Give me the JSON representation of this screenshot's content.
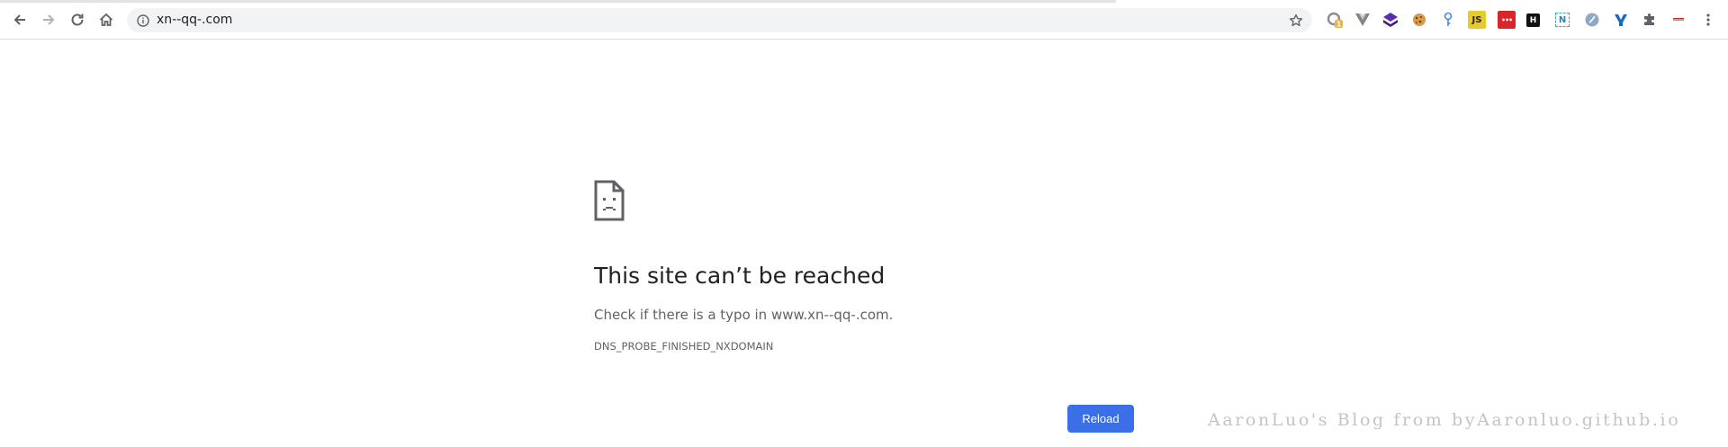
{
  "browser": {
    "url": "xn--qq-.com",
    "extensions": [
      {
        "name": "ext-loading-badge-icon",
        "badge": "1"
      },
      {
        "name": "ext-vue-icon"
      },
      {
        "name": "ext-purple-stack-icon"
      },
      {
        "name": "ext-cookie-icon"
      },
      {
        "name": "ext-key-icon"
      },
      {
        "name": "ext-js-icon",
        "text": "JS"
      },
      {
        "name": "ext-red-dots-icon",
        "text": "•••"
      },
      {
        "name": "ext-h-icon",
        "text": "H"
      },
      {
        "name": "ext-n-icon",
        "text": "N"
      },
      {
        "name": "ext-globe-icon"
      },
      {
        "name": "ext-y-icon"
      },
      {
        "name": "extensions-puzzle-icon"
      },
      {
        "name": "ext-flag-icon"
      }
    ]
  },
  "error": {
    "title": "This site can’t be reached",
    "message": "Check if there is a typo in www.xn--qq-.com.",
    "code": "DNS_PROBE_FINISHED_NXDOMAIN",
    "reload_label": "Reload"
  },
  "watermark": "AaronLuo's Blog from byAaronluo.github.io",
  "colors": {
    "reload_button": "#3a6fe7",
    "title_text": "#202124",
    "secondary_text": "#5f6368"
  }
}
